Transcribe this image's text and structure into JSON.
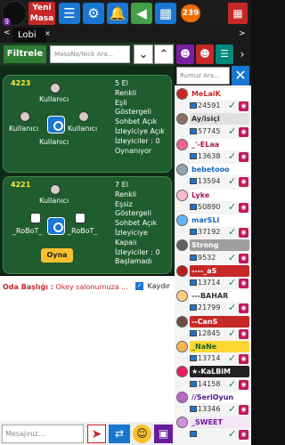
{
  "topbar": {
    "level_badge": "9",
    "new_table_line1": "Yeni",
    "new_table_line2": "Masa",
    "coins": "239"
  },
  "tabs": {
    "active": "Lobi",
    "back_arrow": "<",
    "forward_arrow": ">"
  },
  "filter": {
    "button_label": "Filtrele",
    "search_placeholder": "MasaNo/Nick Ara..."
  },
  "rooms": [
    {
      "id": "4223",
      "seats": [
        "Kullanıcı",
        "Kullanıcı",
        "Kullanıcı",
        "Kullanıcı"
      ],
      "info": [
        "5 El",
        "Renkli",
        "Eşli",
        "Göstergeli",
        "Sohbet Açık",
        "İzleyiciye Açık",
        "İzleyiciler : 0",
        "Oynanıyor"
      ]
    },
    {
      "id": "4221",
      "seats": [
        "Kullanıcı",
        "_RoBoT_",
        "_RoBoT_"
      ],
      "info": [
        "7 El",
        "Renkli",
        "Eşsiz",
        "Göstergeli",
        "Sohbet Açık",
        "İzleyiciye Kapalı",
        "İzleyiciler : 0",
        "Başlamadı"
      ],
      "play_label": "Oyna"
    }
  ],
  "chat": {
    "room_title_label": "Oda Başlığı :",
    "room_title_text": "Okey salonumuza ...",
    "scroll_label": "Kaydır"
  },
  "message_bar": {
    "placeholder": "Mesajınız..."
  },
  "user_panel": {
    "search_placeholder": "Rumuz Ara..."
  },
  "users": [
    {
      "name": "MeLaiK",
      "color": "#c62828",
      "bg": "#ffffff",
      "avatar": "#c62828"
    },
    {
      "num": "24591"
    },
    {
      "name": "Ay/isiçi",
      "color": "#333333",
      "bg": "#e0e0e0",
      "avatar": "#8d6e63"
    },
    {
      "num": "57745"
    },
    {
      "name": "_'-ELaa",
      "color": "#ad1457",
      "bg": "#ffffff",
      "avatar": "#f06292"
    },
    {
      "num": "13638"
    },
    {
      "name": "bebetooo",
      "color": "#1565c0",
      "bg": "#ffffff",
      "avatar": "#90a4ae"
    },
    {
      "num": "13594"
    },
    {
      "name": "Lyke",
      "color": "#ad1457",
      "bg": "#ffffff",
      "avatar": "#f8bbd0"
    },
    {
      "num": "50890"
    },
    {
      "name": "marSLl",
      "color": "#1565c0",
      "bg": "#ffffff",
      "avatar": "#64b5f6"
    },
    {
      "num": "37192"
    },
    {
      "name": "Strong",
      "color": "#ffffff",
      "bg": "#9e9e9e",
      "avatar": "#616161"
    },
    {
      "num": "9532"
    },
    {
      "name": "----_aS",
      "color": "#ffffff",
      "bg": "#c62828",
      "avatar": "#b71c1c"
    },
    {
      "num": "13714"
    },
    {
      "name": "---BAHAR",
      "color": "#333333",
      "bg": "#ffffff",
      "avatar": "#ffcc80"
    },
    {
      "num": "21799"
    },
    {
      "name": "--CanS",
      "color": "#ffffff",
      "bg": "#c62828",
      "avatar": "#6d4c41"
    },
    {
      "num": "12845"
    },
    {
      "name": "_NaNe",
      "color": "#1b5e20",
      "bg": "#fdd835",
      "avatar": "#ffb74d"
    },
    {
      "num": "13714"
    },
    {
      "name": "★-KaLBiM",
      "color": "#ffffff",
      "bg": "#212121",
      "avatar": "#e91e63"
    },
    {
      "num": "14158"
    },
    {
      "name": "//SeriOyun",
      "color": "#4a148c",
      "bg": "#ffffff",
      "avatar": "#ba68c8"
    },
    {
      "num": "13346"
    },
    {
      "name": "_SWEET",
      "color": "#6a1b9a",
      "bg": "#f3e5f5",
      "avatar": "#ce93d8"
    },
    {
      "num": ""
    }
  ]
}
